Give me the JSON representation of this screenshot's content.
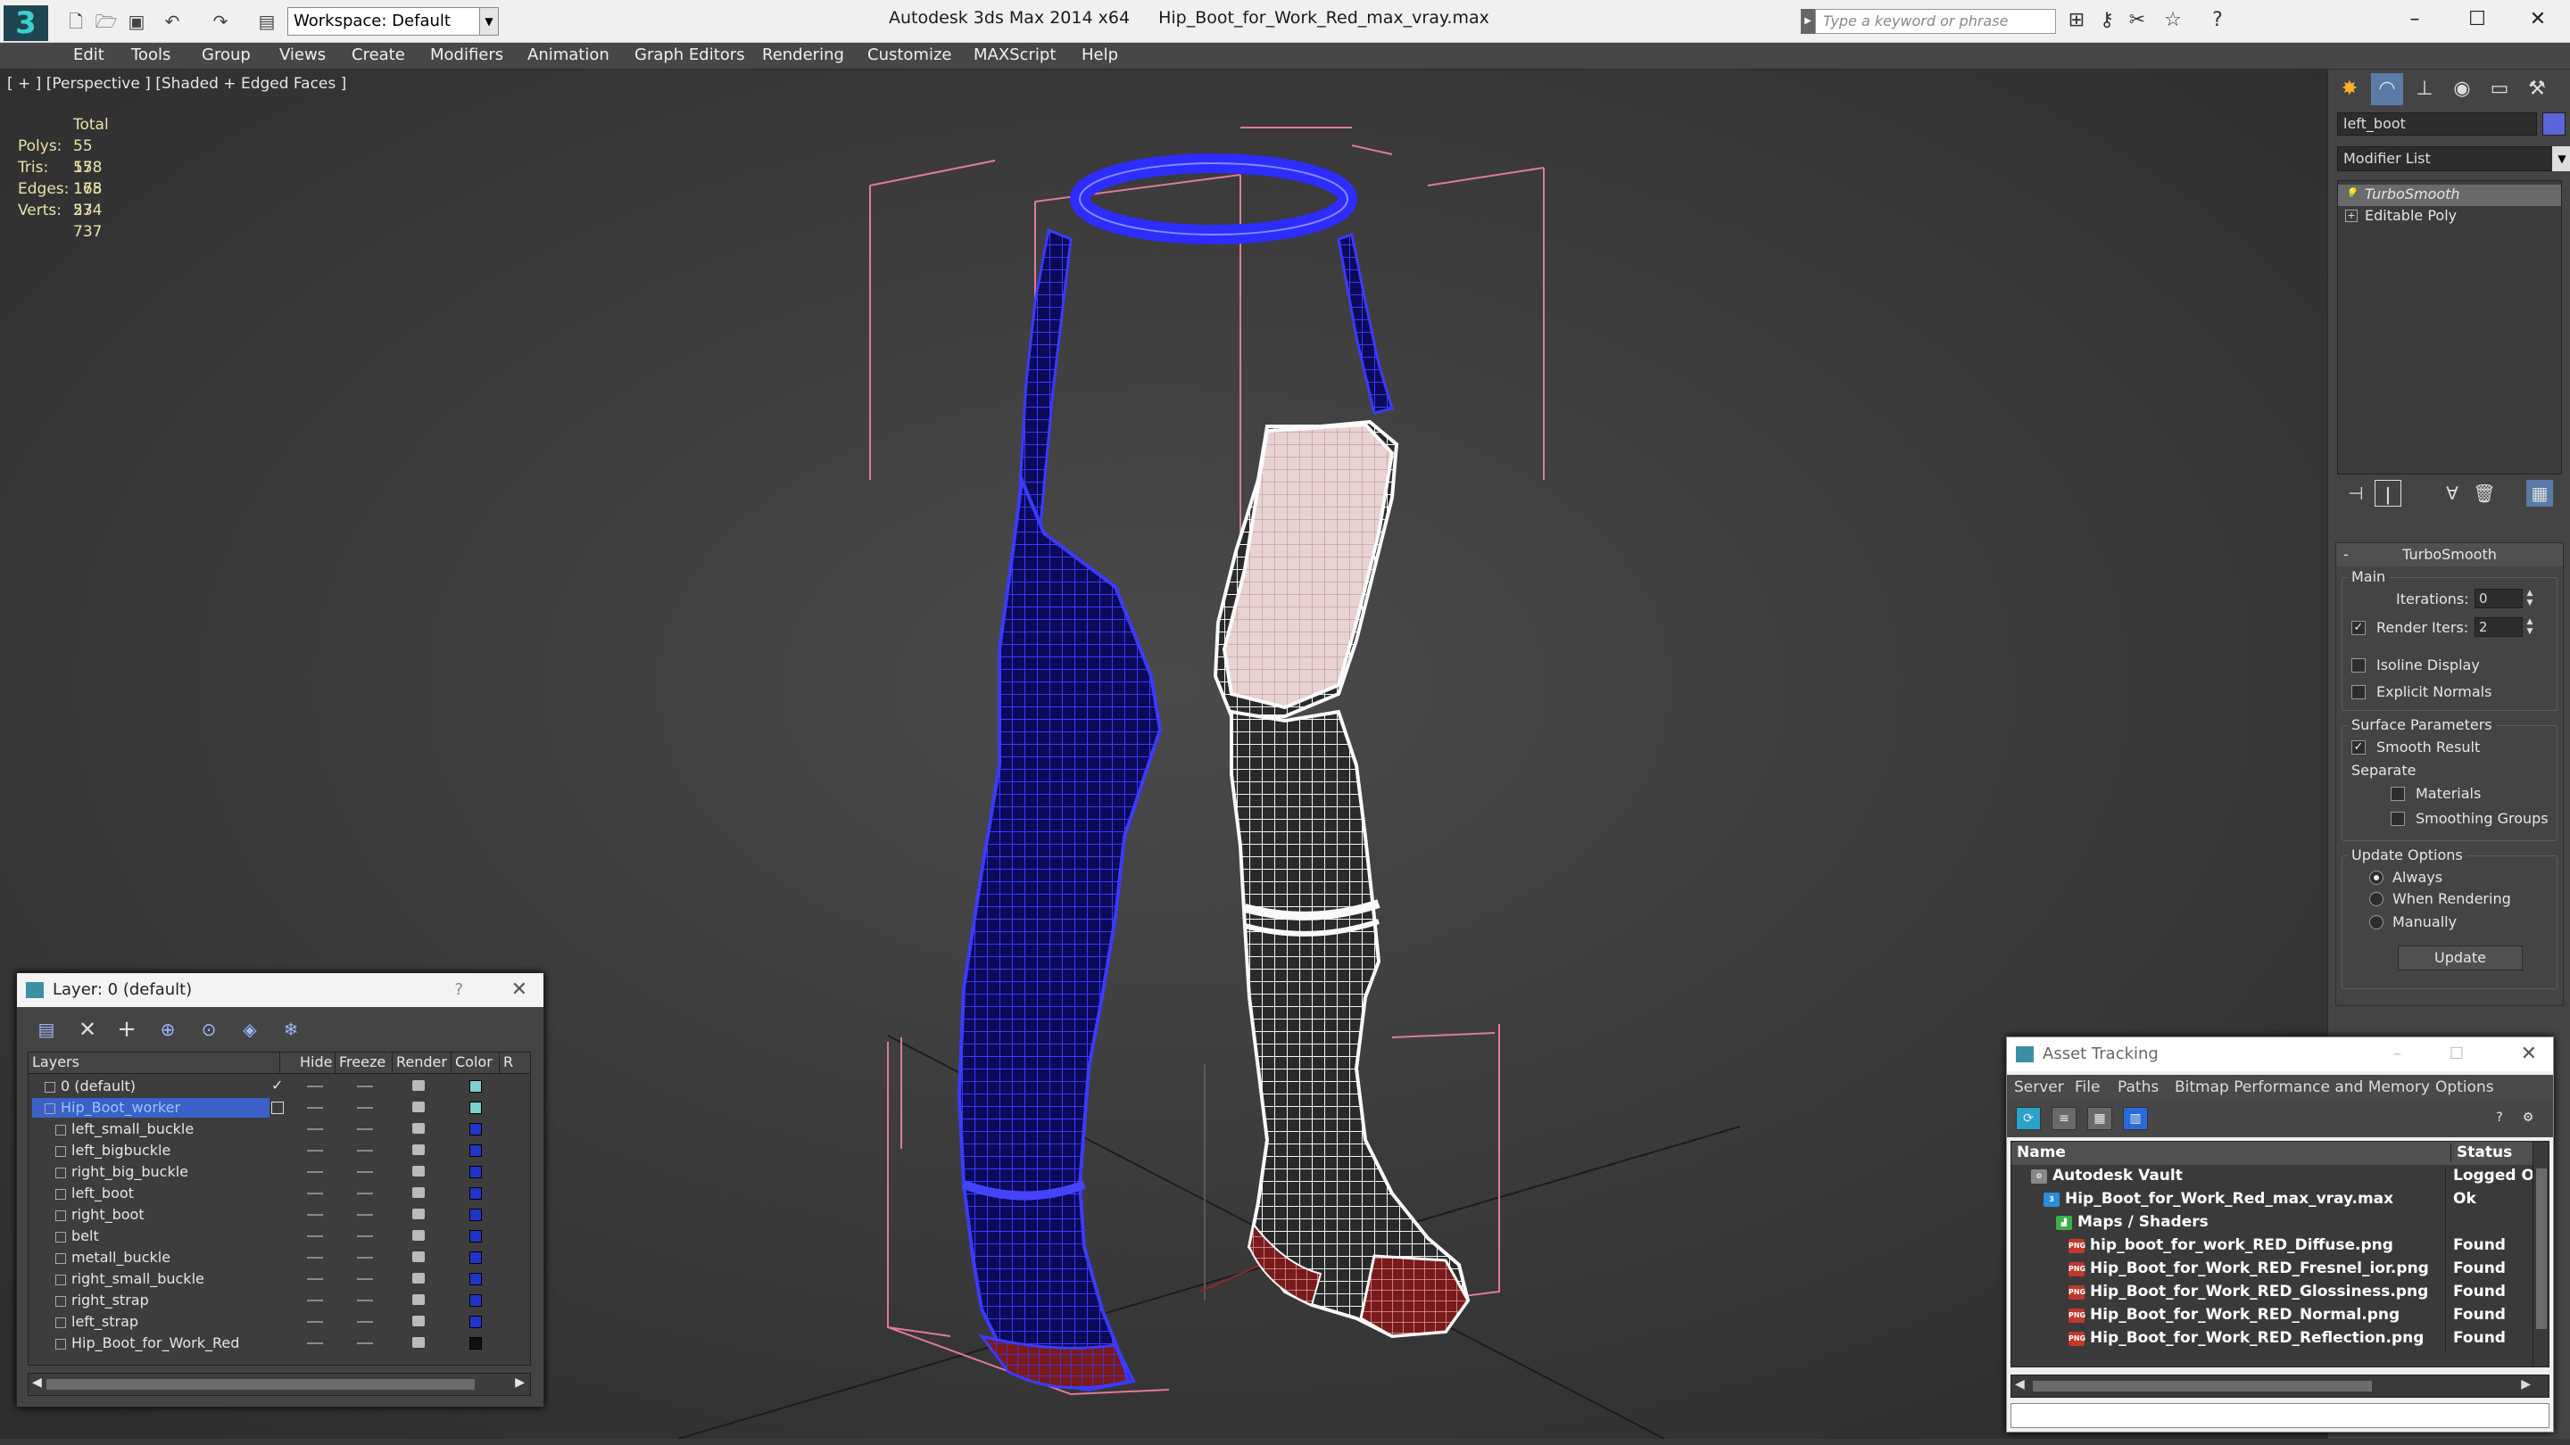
{
  "titlebar": {
    "workspace": "Workspace: Default",
    "app_title": "Autodesk 3ds Max  2014 x64",
    "file_name": "Hip_Boot_for_Work_Red_max_vray.max",
    "search_placeholder": "Type a keyword or phrase",
    "minimize": "–",
    "maximize": "☐",
    "close": "✕"
  },
  "menu": [
    "Edit",
    "Tools",
    "Group",
    "Views",
    "Create",
    "Modifiers",
    "Animation",
    "Graph Editors",
    "Rendering",
    "Customize",
    "MAXScript",
    "Help"
  ],
  "viewport": {
    "label": "[ + ] [Perspective ] [Shaded + Edged Faces ]",
    "stats_header": "Total",
    "stats": [
      {
        "k": "Polys:",
        "v": "55 178"
      },
      {
        "k": "Tris:",
        "v": "55 178"
      },
      {
        "k": "Edges:",
        "v": "165 534"
      },
      {
        "k": "Verts:",
        "v": "27 737"
      }
    ]
  },
  "command_panel": {
    "object_name": "left_boot",
    "object_color": "#5a65d8",
    "modifier_list": "Modifier List",
    "stack": [
      "TurboSmooth",
      "Editable Poly"
    ],
    "turbosmooth": {
      "title": "TurboSmooth",
      "main": "Main",
      "iterations_label": "Iterations:",
      "iterations": "0",
      "render_iters_label": "Render Iters:",
      "render_iters": "2",
      "isoline": "Isoline Display",
      "explicit_normals": "Explicit Normals",
      "surface_params": "Surface Parameters",
      "smooth_result": "Smooth Result",
      "separate": "Separate",
      "materials": "Materials",
      "smoothing_groups": "Smoothing Groups",
      "update_options": "Update Options",
      "always": "Always",
      "when_rendering": "When Rendering",
      "manually": "Manually",
      "update_btn": "Update"
    }
  },
  "layer_dialog": {
    "title": "Layer: 0 (default)",
    "help": "?",
    "close": "✕",
    "columns": [
      "Layers",
      "Hide",
      "Freeze",
      "Render",
      "Color",
      "R"
    ],
    "rows": [
      {
        "name": "0 (default)",
        "color": "#7fd0d0",
        "level": 1,
        "current": true
      },
      {
        "name": "Hip_Boot_worker",
        "color": "#7fd0d0",
        "level": 1,
        "selected": true
      },
      {
        "name": "left_small_buckle",
        "color": "#2035c8",
        "level": 2
      },
      {
        "name": "left_bigbuckle",
        "color": "#2035c8",
        "level": 2
      },
      {
        "name": "right_big_buckle",
        "color": "#2035c8",
        "level": 2
      },
      {
        "name": "left_boot",
        "color": "#2035c8",
        "level": 2
      },
      {
        "name": "right_boot",
        "color": "#2035c8",
        "level": 2
      },
      {
        "name": "belt",
        "color": "#2035c8",
        "level": 2
      },
      {
        "name": "metall_buckle",
        "color": "#2035c8",
        "level": 2
      },
      {
        "name": "right_small_buckle",
        "color": "#2035c8",
        "level": 2
      },
      {
        "name": "right_strap",
        "color": "#2035c8",
        "level": 2
      },
      {
        "name": "left_strap",
        "color": "#2035c8",
        "level": 2
      },
      {
        "name": "Hip_Boot_for_Work_Red",
        "color": "#111111",
        "level": 2
      }
    ]
  },
  "asset_tracking": {
    "title": "Asset Tracking",
    "menu": [
      "Server",
      "File",
      "Paths",
      "Bitmap Performance and Memory",
      "Options"
    ],
    "col_name": "Name",
    "col_status": "Status",
    "rows": [
      {
        "name": "Autodesk Vault",
        "status": "Logged Ou",
        "indent": 1,
        "icon": "vault"
      },
      {
        "name": "Hip_Boot_for_Work_Red_max_vray.max",
        "status": "Ok",
        "indent": 2,
        "icon": "max"
      },
      {
        "name": "Maps / Shaders",
        "status": "",
        "indent": 3,
        "icon": "maps"
      },
      {
        "name": "hip_boot_for_work_RED_Diffuse.png",
        "status": "Found",
        "indent": 4,
        "icon": "png"
      },
      {
        "name": "Hip_Boot_for_Work_RED_Fresnel_ior.png",
        "status": "Found",
        "indent": 4,
        "icon": "png"
      },
      {
        "name": "Hip_Boot_for_Work_RED_Glossiness.png",
        "status": "Found",
        "indent": 4,
        "icon": "png"
      },
      {
        "name": "Hip_Boot_for_Work_RED_Normal.png",
        "status": "Found",
        "indent": 4,
        "icon": "png"
      },
      {
        "name": "Hip_Boot_for_Work_RED_Reflection.png",
        "status": "Found",
        "indent": 4,
        "icon": "png"
      }
    ]
  }
}
